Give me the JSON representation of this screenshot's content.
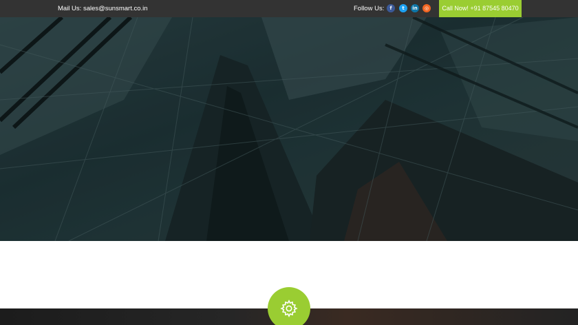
{
  "topbar": {
    "mail_text": "Mail Us: sales@sunsmart.co.in",
    "follow_label": "Follow Us:",
    "social_icons": [
      "facebook-icon",
      "twitter-icon",
      "linkedin-icon",
      "rss-icon"
    ],
    "call_button": "Call Now! +91 87545 80470"
  },
  "colors": {
    "topbar_bg": "#333333",
    "accent": "#9acd32",
    "hero_tint": "#1e3337"
  },
  "features": {
    "badge_icon": "gear-icon"
  }
}
